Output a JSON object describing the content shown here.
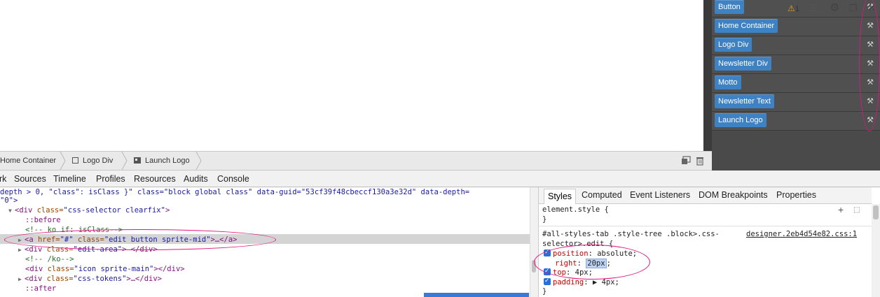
{
  "side_panel": {
    "items": [
      {
        "label": "Button"
      },
      {
        "label": "Home Container"
      },
      {
        "label": "Logo Div"
      },
      {
        "label": "Newsletter Div"
      },
      {
        "label": "Motto"
      },
      {
        "label": "Newsletter Text"
      },
      {
        "label": "Launch Logo"
      }
    ],
    "edit_icon": "wrench-icon"
  },
  "breadcrumb": {
    "items": [
      "Home Container",
      "Logo Div",
      "Launch Logo"
    ]
  },
  "devtools": {
    "tabs": [
      "rk",
      "Sources",
      "Timeline",
      "Profiles",
      "Resources",
      "Audits",
      "Console"
    ],
    "warning_count": "1",
    "elements": {
      "line1": "depth > 0, \"class\": isClass }\" class=\"block global class\" data-guid=\"53cf39f48cbeccf130a3e32d\" data-depth=",
      "line2": "\"0\">",
      "line3_tag": "<div ",
      "line3_attr": "class=",
      "line3_val": "\"css-selector clearfix\"",
      "line3_end": ">",
      "before": "::before",
      "ko_if": "<!-- ko if: isClass-->",
      "sel_tag_open": "<a ",
      "sel_href_attr": "href=",
      "sel_href_val": "\"#\"",
      "sel_class_attr": " class=",
      "sel_class_val": "\"edit button sprite-mid\"",
      "sel_end": ">…</a>",
      "edit_area_tag": "<div ",
      "edit_area_attr": "class=",
      "edit_area_val": "\"edit-area\"",
      "edit_area_end": "> </div>",
      "ko_end": "<!-- /ko-->",
      "icon_tag": "<div ",
      "icon_attr": "class=",
      "icon_val": "\"icon sprite-main\"",
      "icon_end": "></div>",
      "tokens_tag": "<div ",
      "tokens_attr": "class=",
      "tokens_val": "\"css-tokens\"",
      "tokens_end": ">…</div>",
      "after": "::after"
    },
    "styles": {
      "tabs": [
        "Styles",
        "Computed",
        "Event Listeners",
        "DOM Breakpoints",
        "Properties"
      ],
      "element_style": "element.style {",
      "close_brace": "}",
      "rule_selector_1": "#all-styles-tab .style-tree .block>.css-",
      "rule_selector_2": "selector>.edit {",
      "source": "designer.2eb4d54e82.css:1",
      "props": [
        {
          "name": "position",
          "value": "absolute;"
        },
        {
          "name": "right",
          "value": "20px"
        },
        {
          "name": "top",
          "value": "4px;"
        },
        {
          "name": "padding",
          "value": "▶ 4px;"
        }
      ]
    }
  },
  "colors": {
    "annotation": "#e0157f",
    "side_button": "#3e82c4",
    "selection_row": "#d4d4d4"
  }
}
